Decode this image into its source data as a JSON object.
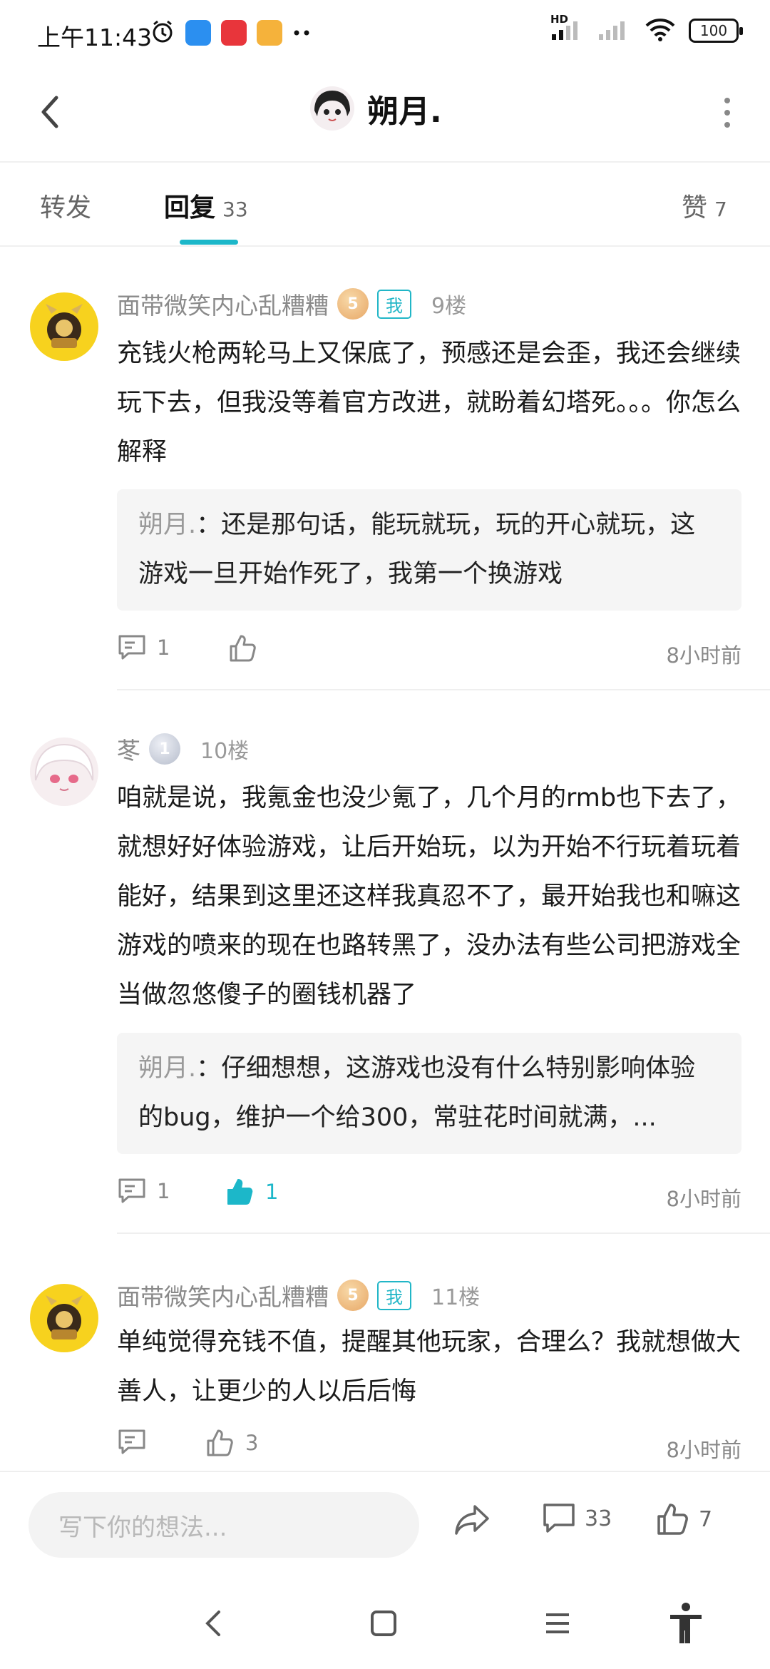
{
  "status_bar": {
    "time": "上午11:43",
    "battery": "100",
    "signal_label": "HD"
  },
  "header": {
    "back_icon": "chevron-left-icon",
    "title": "朔月.",
    "more_icon": "more-vertical-icon"
  },
  "tabs": [
    {
      "label": "转发",
      "count": ""
    },
    {
      "label": "回复",
      "count": "33"
    },
    {
      "label": "赞",
      "count": "7"
    }
  ],
  "comments": [
    {
      "user": "面带微笑内心乱糟糟",
      "level": "5",
      "me_tag": "我",
      "floor": "9楼",
      "text": "充钱火枪两轮马上又保底了，预感还是会歪，我还会继续玩下去，但我没等着官方改进，就盼着幻塔死。。。你怎么解释",
      "reply_name": "朔月.",
      "reply_text": "：还是那句话，能玩就玩，玩的开心就玩，这游戏一旦开始作死了，我第一个换游戏",
      "comment_count": "1",
      "like_count": "",
      "time": "8小时前"
    },
    {
      "user": "苳",
      "level": "1",
      "floor": "10楼",
      "text": "咱就是说，我氪金也没少氪了，几个月的rmb也下去了，就想好好体验游戏，让后开始玩，以为开始不行玩着玩着能好，结果到这里还这样我真忍不了，最开始我也和嘛这游戏的喷来的现在也路转黑了，没办法有些公司把游戏全当做忽悠傻子的圈钱机器了",
      "reply_name": "朔月.",
      "reply_text": "：仔细想想，这游戏也没有什么特别影响体验的bug，维护一个给300，常驻花时间就满，...",
      "comment_count": "1",
      "like_count": "1",
      "time": "8小时前"
    },
    {
      "user": "面带微笑内心乱糟糟",
      "level": "5",
      "me_tag": "我",
      "floor": "11楼",
      "text": "单纯觉得充钱不值，提醒其他玩家，合理么？我就想做大善人，让更少的人以后后悔",
      "comment_count": "",
      "like_count": "3",
      "time": "8小时前"
    }
  ],
  "bottom_bar": {
    "placeholder": "写下你的想法...",
    "comment_count": "33",
    "like_count": "7"
  },
  "colors": {
    "accent": "#1cb7c9",
    "muted_text": "#8a8a8a"
  }
}
